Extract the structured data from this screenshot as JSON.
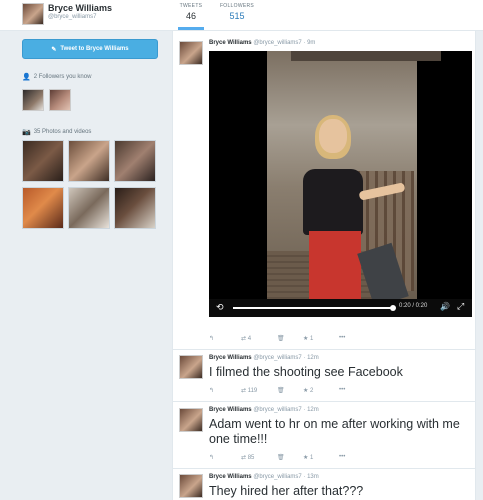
{
  "header": {
    "name": "Bryce Williams",
    "handle": "@bryce_williams7",
    "stats": [
      {
        "label": "TWEETS",
        "value": "46"
      },
      {
        "label": "FOLLOWERS",
        "value": "515"
      }
    ]
  },
  "sidebar": {
    "tweet_button_label": "Tweet to Bryce Williams",
    "followers_label": "2 Followers you know",
    "photos_label": "35 Photos and videos"
  },
  "tweets": [
    {
      "name": "Bryce Williams",
      "handle": "@bryce_williams7",
      "time": "9m",
      "video_time": "0:20 / 0:20",
      "retweets": "4",
      "favorites": "1"
    },
    {
      "name": "Bryce Williams",
      "handle": "@bryce_williams7",
      "time": "12m",
      "text": "I filmed the shooting see Facebook",
      "retweets": "119",
      "favorites": "2"
    },
    {
      "name": "Bryce Williams",
      "handle": "@bryce_williams7",
      "time": "12m",
      "text": "Adam went to hr on me after working with me one time!!!",
      "retweets": "85",
      "favorites": "1"
    },
    {
      "name": "Bryce Williams",
      "handle": "@bryce_williams7",
      "time": "13m",
      "text": "They hired her after that???"
    }
  ],
  "colors": {
    "accent": "#55acee",
    "button": "#4aaee2",
    "link": "#2b7bb9",
    "page_bg": "#e9eef2"
  }
}
